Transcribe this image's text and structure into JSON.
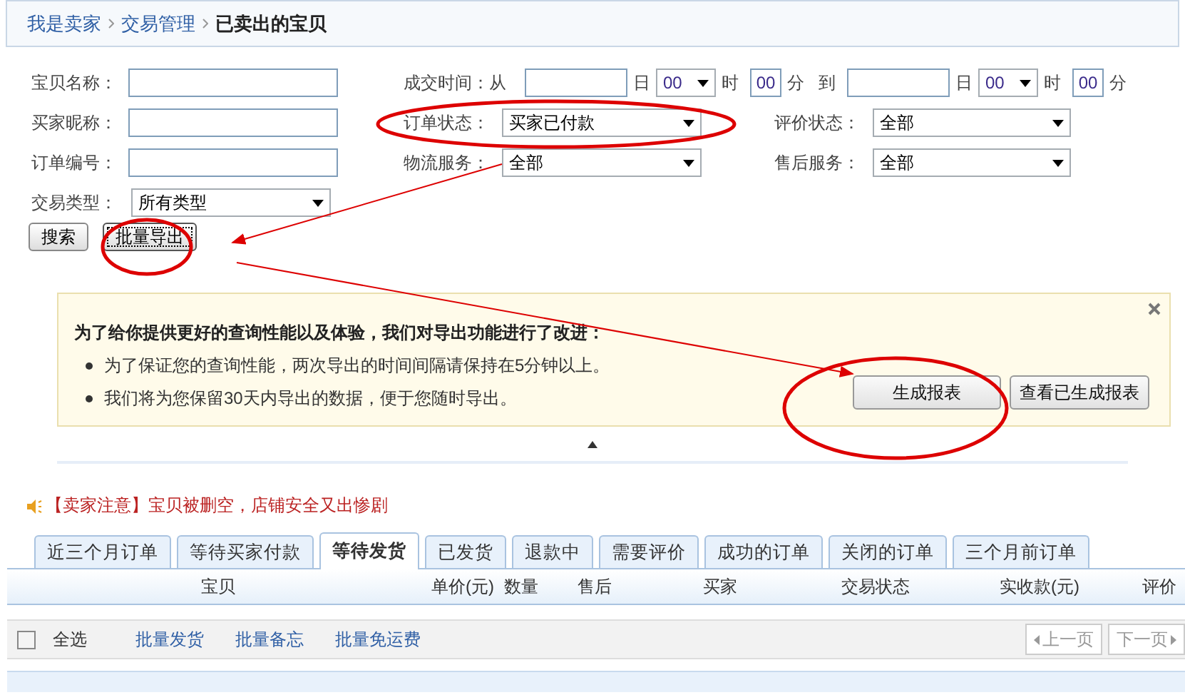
{
  "breadcrumb": {
    "links": [
      "我是卖家",
      "交易管理"
    ],
    "current": "已卖出的宝贝"
  },
  "filters": {
    "item_name": {
      "label": "宝贝名称："
    },
    "buyer_nick": {
      "label": "买家昵称："
    },
    "order_no": {
      "label": "订单编号："
    },
    "trade_type": {
      "label": "交易类型：",
      "value": "所有类型"
    },
    "deal_time": {
      "label": "成交时间：从",
      "separator": "到",
      "from": {
        "day_unit": "日",
        "hour": "00",
        "hour_unit": "时",
        "minute": "00",
        "minute_unit": "分"
      },
      "to": {
        "day_unit": "日",
        "hour": "00",
        "hour_unit": "时",
        "minute": "00",
        "minute_unit": "分"
      }
    },
    "order_status": {
      "label": "订单状态：",
      "value": "买家已付款"
    },
    "logistics": {
      "label": "物流服务：",
      "value": "全部"
    },
    "rating_status": {
      "label": "评价状态：",
      "value": "全部"
    },
    "after_sale": {
      "label": "售后服务：",
      "value": "全部"
    }
  },
  "buttons": [
    {
      "label": "搜索",
      "focused": false
    },
    {
      "label": "批量导出",
      "focused": true
    }
  ],
  "notice": {
    "title": "为了给你提供更好的查询性能以及体验，我们对导出功能进行了改进：",
    "bullets": [
      "为了保证您的查询性能，两次导出的时间间隔请保持在5分钟以上。",
      "我们将为您保留30天内导出的数据，便于您随时导出。"
    ],
    "buttons": [
      "生成报表",
      "查看已生成报表"
    ]
  },
  "alert": "【卖家注意】宝贝被删空，店铺安全又出惨剧",
  "tabs": [
    {
      "label": "近三个月订单",
      "selected": false
    },
    {
      "label": "等待买家付款",
      "selected": false
    },
    {
      "label": "等待发货",
      "selected": true
    },
    {
      "label": "已发货",
      "selected": false
    },
    {
      "label": "退款中",
      "selected": false
    },
    {
      "label": "需要评价",
      "selected": false
    },
    {
      "label": "成功的订单",
      "selected": false
    },
    {
      "label": "关闭的订单",
      "selected": false
    },
    {
      "label": "三个月前订单",
      "selected": false
    }
  ],
  "table": {
    "columns": [
      "宝贝",
      "单价(元)",
      "数量",
      "售后",
      "买家",
      "交易状态",
      "实收款(元)",
      "评价"
    ]
  },
  "toolbar": {
    "select_all": {
      "label": "全选",
      "checked": false
    },
    "actions": [
      "批量发货",
      "批量备忘",
      "批量免运费"
    ],
    "pager": {
      "prev": "上一页",
      "next": "下一页"
    }
  }
}
